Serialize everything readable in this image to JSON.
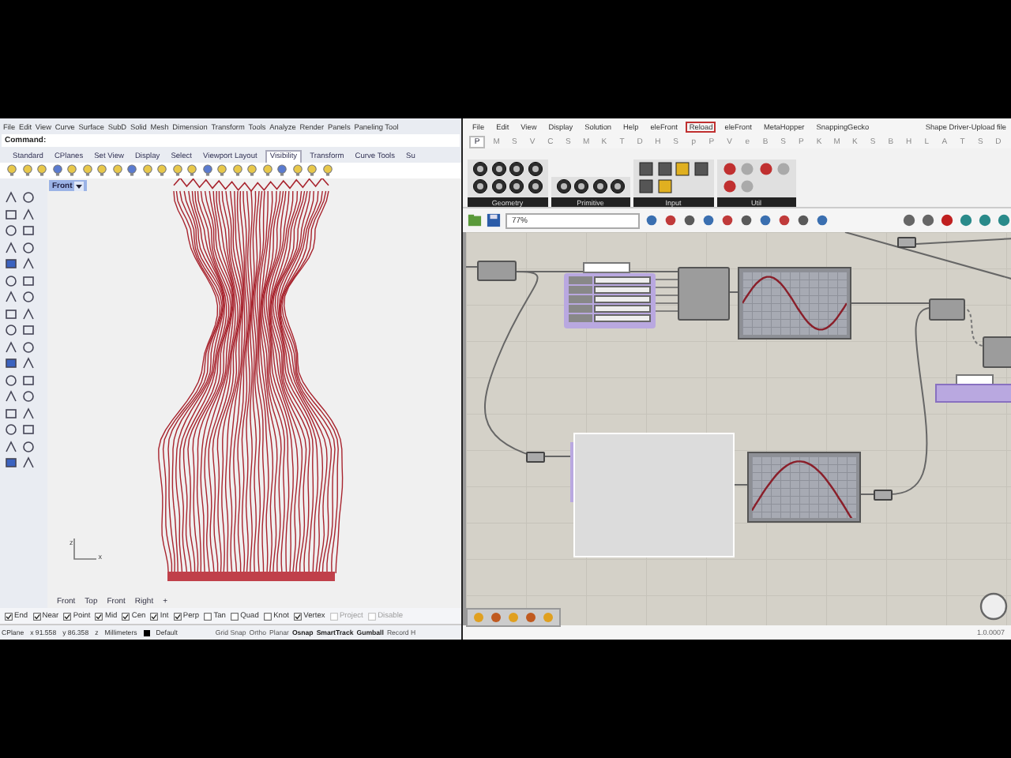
{
  "rhino": {
    "menu": [
      "File",
      "Edit",
      "View",
      "Curve",
      "Surface",
      "SubD",
      "Solid",
      "Mesh",
      "Dimension",
      "Transform",
      "Tools",
      "Analyze",
      "Render",
      "Panels",
      "Paneling Tool"
    ],
    "command_label": "Command:",
    "tabs": [
      {
        "label": "Standard",
        "selected": false
      },
      {
        "label": "CPlanes",
        "selected": false
      },
      {
        "label": "Set View",
        "selected": false
      },
      {
        "label": "Display",
        "selected": false
      },
      {
        "label": "Select",
        "selected": false
      },
      {
        "label": "Viewport Layout",
        "selected": false
      },
      {
        "label": "Visibility",
        "selected": true
      },
      {
        "label": "Transform",
        "selected": false
      },
      {
        "label": "Curve Tools",
        "selected": false
      },
      {
        "label": "Su",
        "selected": false
      }
    ],
    "viewport": {
      "label": "Front",
      "axis_z": "z",
      "axis_x": "x"
    },
    "viewport_tabs": [
      "Front",
      "Top",
      "Front",
      "Right",
      "+"
    ],
    "osnaps": [
      {
        "label": "End",
        "checked": true,
        "disabled": false
      },
      {
        "label": "Near",
        "checked": true,
        "disabled": false
      },
      {
        "label": "Point",
        "checked": true,
        "disabled": false
      },
      {
        "label": "Mid",
        "checked": true,
        "disabled": false
      },
      {
        "label": "Cen",
        "checked": true,
        "disabled": false
      },
      {
        "label": "Int",
        "checked": true,
        "disabled": false
      },
      {
        "label": "Perp",
        "checked": true,
        "disabled": false
      },
      {
        "label": "Tan",
        "checked": false,
        "disabled": false
      },
      {
        "label": "Quad",
        "checked": false,
        "disabled": false
      },
      {
        "label": "Knot",
        "checked": false,
        "disabled": false
      },
      {
        "label": "Vertex",
        "checked": true,
        "disabled": false
      },
      {
        "label": "Project",
        "checked": false,
        "disabled": true
      },
      {
        "label": "Disable",
        "checked": false,
        "disabled": true
      }
    ],
    "status": {
      "cplane": "CPlane",
      "x": "x 91.558",
      "y": "y 86.358",
      "z": "z",
      "units": "Millimeters",
      "layer": "Default",
      "toggles": [
        {
          "label": "Grid Snap",
          "on": false
        },
        {
          "label": "Ortho",
          "on": false
        },
        {
          "label": "Planar",
          "on": false
        },
        {
          "label": "Osnap",
          "on": true
        },
        {
          "label": "SmartTrack",
          "on": true
        },
        {
          "label": "Gumball",
          "on": true
        },
        {
          "label": "Record H",
          "on": false
        }
      ]
    }
  },
  "grasshopper": {
    "menu": [
      {
        "label": "File",
        "boxed": false
      },
      {
        "label": "Edit",
        "boxed": false
      },
      {
        "label": "View",
        "boxed": false
      },
      {
        "label": "Display",
        "boxed": false
      },
      {
        "label": "Solution",
        "boxed": false
      },
      {
        "label": "Help",
        "boxed": false
      },
      {
        "label": "eleFront",
        "boxed": false
      },
      {
        "label": "Reload",
        "boxed": true
      },
      {
        "label": "eleFront",
        "boxed": false
      },
      {
        "label": "MetaHopper",
        "boxed": false
      },
      {
        "label": "SnappingGecko",
        "boxed": false
      }
    ],
    "document": "Shape Driver-Upload file",
    "tabs": [
      {
        "label": "P",
        "selected": true
      },
      {
        "label": "M",
        "selected": false
      },
      {
        "label": "S",
        "selected": false
      },
      {
        "label": "V",
        "selected": false
      },
      {
        "label": "C",
        "selected": false
      },
      {
        "label": "S",
        "selected": false
      },
      {
        "label": "M",
        "selected": false
      },
      {
        "label": "K",
        "selected": false
      },
      {
        "label": "T",
        "selected": false
      },
      {
        "label": "D",
        "selected": false
      },
      {
        "label": "H",
        "selected": false
      },
      {
        "label": "S",
        "selected": false
      },
      {
        "label": "p",
        "selected": false
      },
      {
        "label": "P",
        "selected": false
      },
      {
        "label": "V",
        "selected": false
      },
      {
        "label": "e",
        "selected": false
      },
      {
        "label": "B",
        "selected": false
      },
      {
        "label": "S",
        "selected": false
      },
      {
        "label": "P",
        "selected": false
      },
      {
        "label": "K",
        "selected": false
      },
      {
        "label": "M",
        "selected": false
      },
      {
        "label": "K",
        "selected": false
      },
      {
        "label": "S",
        "selected": false
      },
      {
        "label": "B",
        "selected": false
      },
      {
        "label": "H",
        "selected": false
      },
      {
        "label": "L",
        "selected": false
      },
      {
        "label": "A",
        "selected": false
      },
      {
        "label": "T",
        "selected": false
      },
      {
        "label": "S",
        "selected": false
      },
      {
        "label": "D",
        "selected": false
      }
    ],
    "groups": [
      {
        "label": "Geometry"
      },
      {
        "label": "Primitive"
      },
      {
        "label": "Input"
      },
      {
        "label": "Util"
      }
    ],
    "zoom": "77%",
    "version": "1.0.0007"
  }
}
